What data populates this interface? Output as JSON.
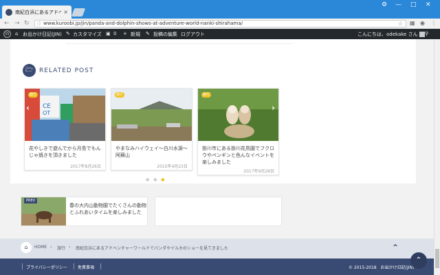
{
  "browser": {
    "tab_title": "南紀白浜にあるアドベンチャ",
    "tab_close": "×",
    "url": "www.kuroobi.jp/jin/panda-and-dolphin-shows-at-adventure-world-nanki-shirahama/",
    "icons": {
      "back": "arrow-left-icon",
      "forward": "arrow-right-icon",
      "reload": "reload-icon",
      "star": "star-icon",
      "menu": "kebab-menu-icon"
    }
  },
  "wp_admin_bar": {
    "site_name": "お出かけ日記(JIN)",
    "customize": "カスタマイズ",
    "comments_count": "0",
    "new": "新規",
    "edit_post": "投稿の編集",
    "logout": "ログアウト",
    "greeting": "こんにちは、odekake さん"
  },
  "related": {
    "heading": "RELATED POST",
    "cards": [
      {
        "tag": "旅行",
        "title": "花やしきで遊んでから月島でもんじゃ焼きを頂きました",
        "date": "2017年8月26日"
      },
      {
        "tag": "旅行",
        "title": "やまなみハイウェイ～白川水源～阿蘇山",
        "date": "2015年4月23日"
      },
      {
        "tag": "旅行",
        "title": "掛川市にある掛川花鳥園でフクロウやペンギンと色んなイベントを楽しみました",
        "date": "2017年9月28日"
      }
    ],
    "arrow_prev": "‹",
    "arrow_next": "›"
  },
  "pager": {
    "prev_label": "PREV",
    "prev_title": "春の大内山動物園でたくさんの動物とふれあいタイムを楽しみました"
  },
  "breadcrumb": {
    "home": "HOME",
    "sep": "›",
    "category": "旅行",
    "current": "南紀白浜にあるアドベンチャーワールドでパンダやイルカのショーを見てきました"
  },
  "footer": {
    "privacy": "プライバシーポリシー",
    "disclaimer": "免責事項",
    "copyright": "© 2015-2018　お出かけ日記(JIN)"
  },
  "colors": {
    "accent": "#3a4b73",
    "tag": "#f0c020",
    "browser_chrome": "#2b88d8"
  }
}
